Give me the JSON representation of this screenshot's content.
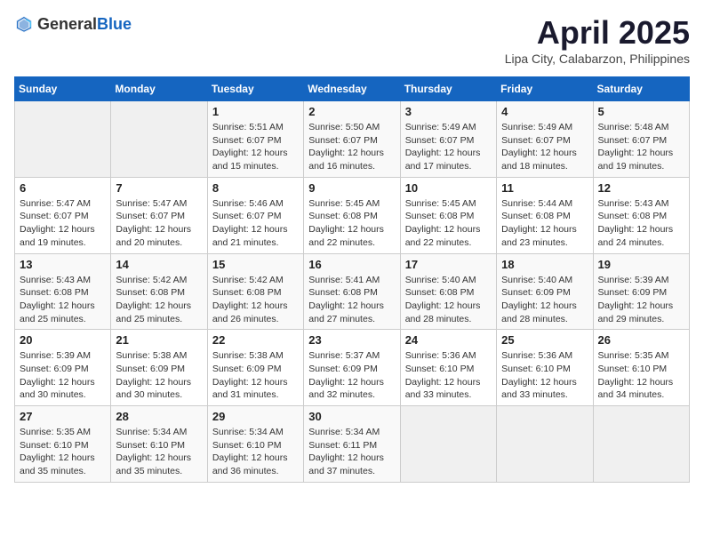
{
  "header": {
    "logo_general": "General",
    "logo_blue": "Blue",
    "title": "April 2025",
    "location": "Lipa City, Calabarzon, Philippines"
  },
  "weekdays": [
    "Sunday",
    "Monday",
    "Tuesday",
    "Wednesday",
    "Thursday",
    "Friday",
    "Saturday"
  ],
  "weeks": [
    [
      {
        "day": "",
        "empty": true
      },
      {
        "day": "",
        "empty": true
      },
      {
        "day": "1",
        "sunrise": "5:51 AM",
        "sunset": "6:07 PM",
        "daylight": "12 hours and 15 minutes."
      },
      {
        "day": "2",
        "sunrise": "5:50 AM",
        "sunset": "6:07 PM",
        "daylight": "12 hours and 16 minutes."
      },
      {
        "day": "3",
        "sunrise": "5:49 AM",
        "sunset": "6:07 PM",
        "daylight": "12 hours and 17 minutes."
      },
      {
        "day": "4",
        "sunrise": "5:49 AM",
        "sunset": "6:07 PM",
        "daylight": "12 hours and 18 minutes."
      },
      {
        "day": "5",
        "sunrise": "5:48 AM",
        "sunset": "6:07 PM",
        "daylight": "12 hours and 19 minutes."
      }
    ],
    [
      {
        "day": "6",
        "sunrise": "5:47 AM",
        "sunset": "6:07 PM",
        "daylight": "12 hours and 19 minutes."
      },
      {
        "day": "7",
        "sunrise": "5:47 AM",
        "sunset": "6:07 PM",
        "daylight": "12 hours and 20 minutes."
      },
      {
        "day": "8",
        "sunrise": "5:46 AM",
        "sunset": "6:07 PM",
        "daylight": "12 hours and 21 minutes."
      },
      {
        "day": "9",
        "sunrise": "5:45 AM",
        "sunset": "6:08 PM",
        "daylight": "12 hours and 22 minutes."
      },
      {
        "day": "10",
        "sunrise": "5:45 AM",
        "sunset": "6:08 PM",
        "daylight": "12 hours and 22 minutes."
      },
      {
        "day": "11",
        "sunrise": "5:44 AM",
        "sunset": "6:08 PM",
        "daylight": "12 hours and 23 minutes."
      },
      {
        "day": "12",
        "sunrise": "5:43 AM",
        "sunset": "6:08 PM",
        "daylight": "12 hours and 24 minutes."
      }
    ],
    [
      {
        "day": "13",
        "sunrise": "5:43 AM",
        "sunset": "6:08 PM",
        "daylight": "12 hours and 25 minutes."
      },
      {
        "day": "14",
        "sunrise": "5:42 AM",
        "sunset": "6:08 PM",
        "daylight": "12 hours and 25 minutes."
      },
      {
        "day": "15",
        "sunrise": "5:42 AM",
        "sunset": "6:08 PM",
        "daylight": "12 hours and 26 minutes."
      },
      {
        "day": "16",
        "sunrise": "5:41 AM",
        "sunset": "6:08 PM",
        "daylight": "12 hours and 27 minutes."
      },
      {
        "day": "17",
        "sunrise": "5:40 AM",
        "sunset": "6:08 PM",
        "daylight": "12 hours and 28 minutes."
      },
      {
        "day": "18",
        "sunrise": "5:40 AM",
        "sunset": "6:09 PM",
        "daylight": "12 hours and 28 minutes."
      },
      {
        "day": "19",
        "sunrise": "5:39 AM",
        "sunset": "6:09 PM",
        "daylight": "12 hours and 29 minutes."
      }
    ],
    [
      {
        "day": "20",
        "sunrise": "5:39 AM",
        "sunset": "6:09 PM",
        "daylight": "12 hours and 30 minutes."
      },
      {
        "day": "21",
        "sunrise": "5:38 AM",
        "sunset": "6:09 PM",
        "daylight": "12 hours and 30 minutes."
      },
      {
        "day": "22",
        "sunrise": "5:38 AM",
        "sunset": "6:09 PM",
        "daylight": "12 hours and 31 minutes."
      },
      {
        "day": "23",
        "sunrise": "5:37 AM",
        "sunset": "6:09 PM",
        "daylight": "12 hours and 32 minutes."
      },
      {
        "day": "24",
        "sunrise": "5:36 AM",
        "sunset": "6:10 PM",
        "daylight": "12 hours and 33 minutes."
      },
      {
        "day": "25",
        "sunrise": "5:36 AM",
        "sunset": "6:10 PM",
        "daylight": "12 hours and 33 minutes."
      },
      {
        "day": "26",
        "sunrise": "5:35 AM",
        "sunset": "6:10 PM",
        "daylight": "12 hours and 34 minutes."
      }
    ],
    [
      {
        "day": "27",
        "sunrise": "5:35 AM",
        "sunset": "6:10 PM",
        "daylight": "12 hours and 35 minutes."
      },
      {
        "day": "28",
        "sunrise": "5:34 AM",
        "sunset": "6:10 PM",
        "daylight": "12 hours and 35 minutes."
      },
      {
        "day": "29",
        "sunrise": "5:34 AM",
        "sunset": "6:10 PM",
        "daylight": "12 hours and 36 minutes."
      },
      {
        "day": "30",
        "sunrise": "5:34 AM",
        "sunset": "6:11 PM",
        "daylight": "12 hours and 37 minutes."
      },
      {
        "day": "",
        "empty": true
      },
      {
        "day": "",
        "empty": true
      },
      {
        "day": "",
        "empty": true
      }
    ]
  ]
}
